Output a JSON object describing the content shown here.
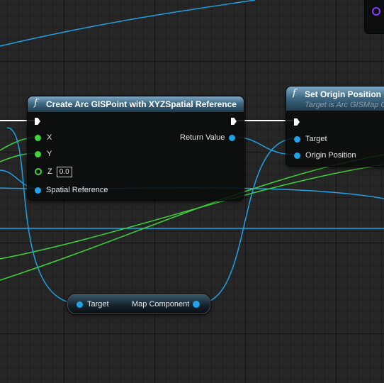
{
  "create_node": {
    "title": "Create Arc GISPoint with XYZSpatial Reference",
    "function_glyph": "f",
    "pins": {
      "x_label": "X",
      "y_label": "Y",
      "z_label": "Z",
      "z_value": "0.0",
      "spatial_reference_label": "Spatial Reference",
      "return_value_label": "Return Value"
    }
  },
  "set_origin_node": {
    "title": "Set Origin Position",
    "subtitle": "Target is Arc GISMap C",
    "function_glyph": "f",
    "pins": {
      "target_label": "Target",
      "origin_position_label": "Origin Position"
    }
  },
  "map_component_node": {
    "target_label": "Target",
    "output_label": "Map Component"
  },
  "colors": {
    "vector_pin": "#3fd43a",
    "object_pin": "#1fa3e6",
    "exec_wire": "#ffffff",
    "header_top": "#7fa9c4",
    "header_bottom": "#1f3b4e",
    "interface_pin": "#8a3cff"
  }
}
